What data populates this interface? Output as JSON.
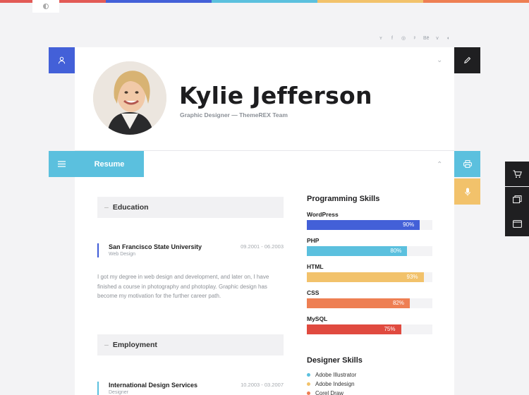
{
  "colors": {
    "stripes": [
      "#e25a56",
      "#4360d8",
      "#5bc0de",
      "#f2c26b",
      "#ee7f53"
    ],
    "blue": "#4360d8",
    "cyan": "#5bc0de",
    "yellow": "#f2c26b",
    "orange": "#ee7f53",
    "red": "#e04a3f",
    "dark": "#1f1f21"
  },
  "social_icons": [
    "twitter-icon",
    "facebook-icon",
    "instagram-icon",
    "pinterest-icon",
    "behance-icon",
    "vimeo-icon",
    "dribbble-icon"
  ],
  "social_glyphs": [
    "ʏ",
    "f",
    "◎",
    "ᵖ",
    "Bē",
    "v",
    "◐"
  ],
  "profile": {
    "name": "Kylie Jefferson",
    "subtitle": "Graphic Designer — ThemeREX Team"
  },
  "resume_tab": "Resume",
  "education": {
    "heading": "Education",
    "entry": {
      "title": "San Francisco State University",
      "role": "Web Design",
      "date": "09.2001 - 06.2003"
    },
    "description": "I got my degree in web design and development, and later on, I have finished a course in photography and photoplay. Graphic design has become my motivation for the further career path."
  },
  "employment": {
    "heading": "Employment",
    "entry": {
      "title": "International Design Services",
      "role": "Designer",
      "date": "10.2003 - 03.2007"
    }
  },
  "programming_skills": {
    "title": "Programming Skills",
    "items": [
      {
        "name": "WordPress",
        "value": "90%",
        "fraction": 0.9,
        "color": "#4360d8"
      },
      {
        "name": "PHP",
        "value": "80%",
        "fraction": 0.8,
        "color": "#5bc0de"
      },
      {
        "name": "HTML",
        "value": "93%",
        "fraction": 0.93,
        "color": "#f2c26b"
      },
      {
        "name": "CSS",
        "value": "82%",
        "fraction": 0.82,
        "color": "#ee7f53"
      },
      {
        "name": "MySQL",
        "value": "75%",
        "fraction": 0.75,
        "color": "#e04a3f"
      }
    ]
  },
  "designer_skills": {
    "title": "Designer Skills",
    "items": [
      {
        "name": "Adobe Illustrator",
        "color": "#5bc0de"
      },
      {
        "name": "Adobe Indesign",
        "color": "#f2c26b"
      },
      {
        "name": "Corel Draw",
        "color": "#ee7f53"
      }
    ]
  }
}
